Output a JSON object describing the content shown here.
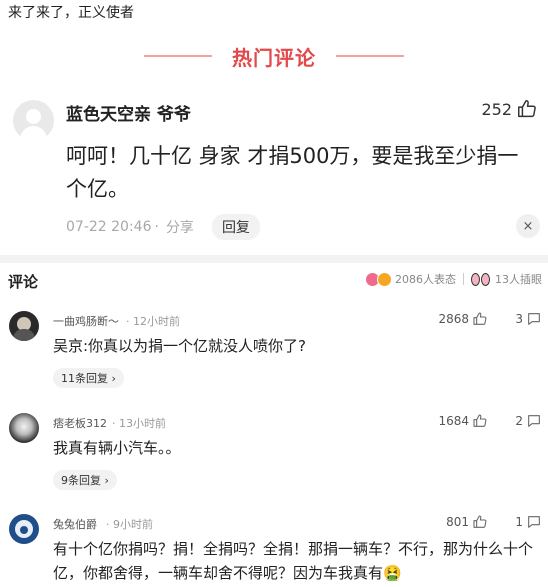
{
  "top_text": "来了来了，正义使者",
  "section_title": "热门评论",
  "hot": {
    "username": "蓝色天空亲 爷爷",
    "likes": "252",
    "text": "呵呵！几十亿 身家 才捐500万，要是我至少捐一个亿。",
    "timestamp": "07-22 20:46",
    "dot": "·",
    "share_label": "分享",
    "reply_label": "回复",
    "close_glyph": "×"
  },
  "comment_bar": {
    "label": "评论",
    "reactions": "2086人表态",
    "viewers": "13人插眼"
  },
  "comments": [
    {
      "username": "一曲鸡肠断～",
      "time": "12小时前",
      "likes": "2868",
      "reply_count": "3",
      "text": "吴京:你真以为捐一个亿就没人喷你了?",
      "reply_chip": "11条回复 ›"
    },
    {
      "username": "痞老板312",
      "time": "13小时前",
      "likes": "1684",
      "reply_count": "2",
      "text": "我真有辆小汽车。。",
      "reply_chip": "9条回复 ›"
    },
    {
      "username": "兔兔伯爵",
      "time": "9小时前",
      "likes": "801",
      "reply_count": "1",
      "text": "有十个亿你捐吗？捐！全捐吗？全捐！那捐一辆车？不行，那为什么十个亿，你都舍得，一辆车却舍不得呢？因为车我真有🤮",
      "reply_chip": ""
    }
  ],
  "colors": {
    "accent_red": "#e24a4a",
    "muted_text": "#999999"
  },
  "icons": {
    "like": "thumbs-up-icon",
    "reply": "comment-bubble-icon",
    "avatar": "default-avatar-icon"
  }
}
